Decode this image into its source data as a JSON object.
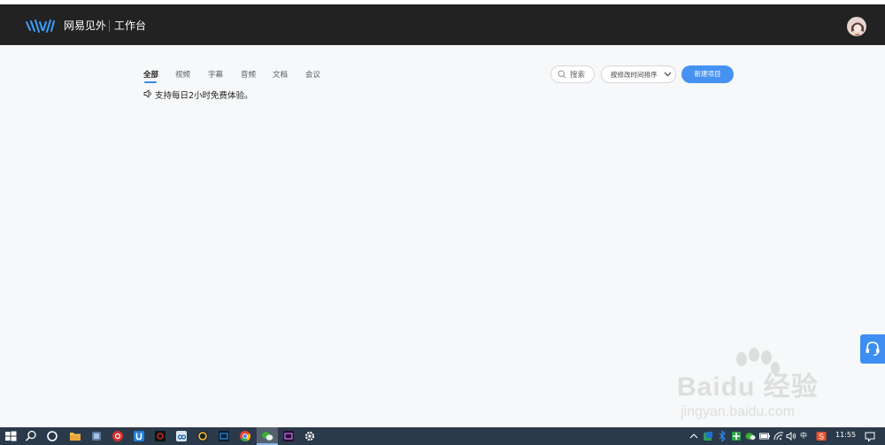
{
  "header": {
    "brand": "网易见外",
    "workbench": "工作台"
  },
  "tabs": [
    {
      "label": "全部",
      "active": true
    },
    {
      "label": "视频",
      "active": false
    },
    {
      "label": "字幕",
      "active": false
    },
    {
      "label": "音频",
      "active": false
    },
    {
      "label": "文档",
      "active": false
    },
    {
      "label": "会议",
      "active": false
    }
  ],
  "notice": {
    "text": "支持每日2小时免费体验。"
  },
  "toolbar": {
    "search_label": "搜索",
    "sort_label": "按修改时间排序",
    "new_project_label": "新建项目"
  },
  "watermark": {
    "main": "Baidu 经验",
    "sub": "jingyan.baidu.com"
  },
  "taskbar": {
    "ime": "中",
    "clock": "11:55"
  },
  "colors": {
    "header_bg": "#222222",
    "accent": "#4592f3",
    "page_bg": "#f7f8f9",
    "taskbar_bg": "#2b3a4a"
  }
}
